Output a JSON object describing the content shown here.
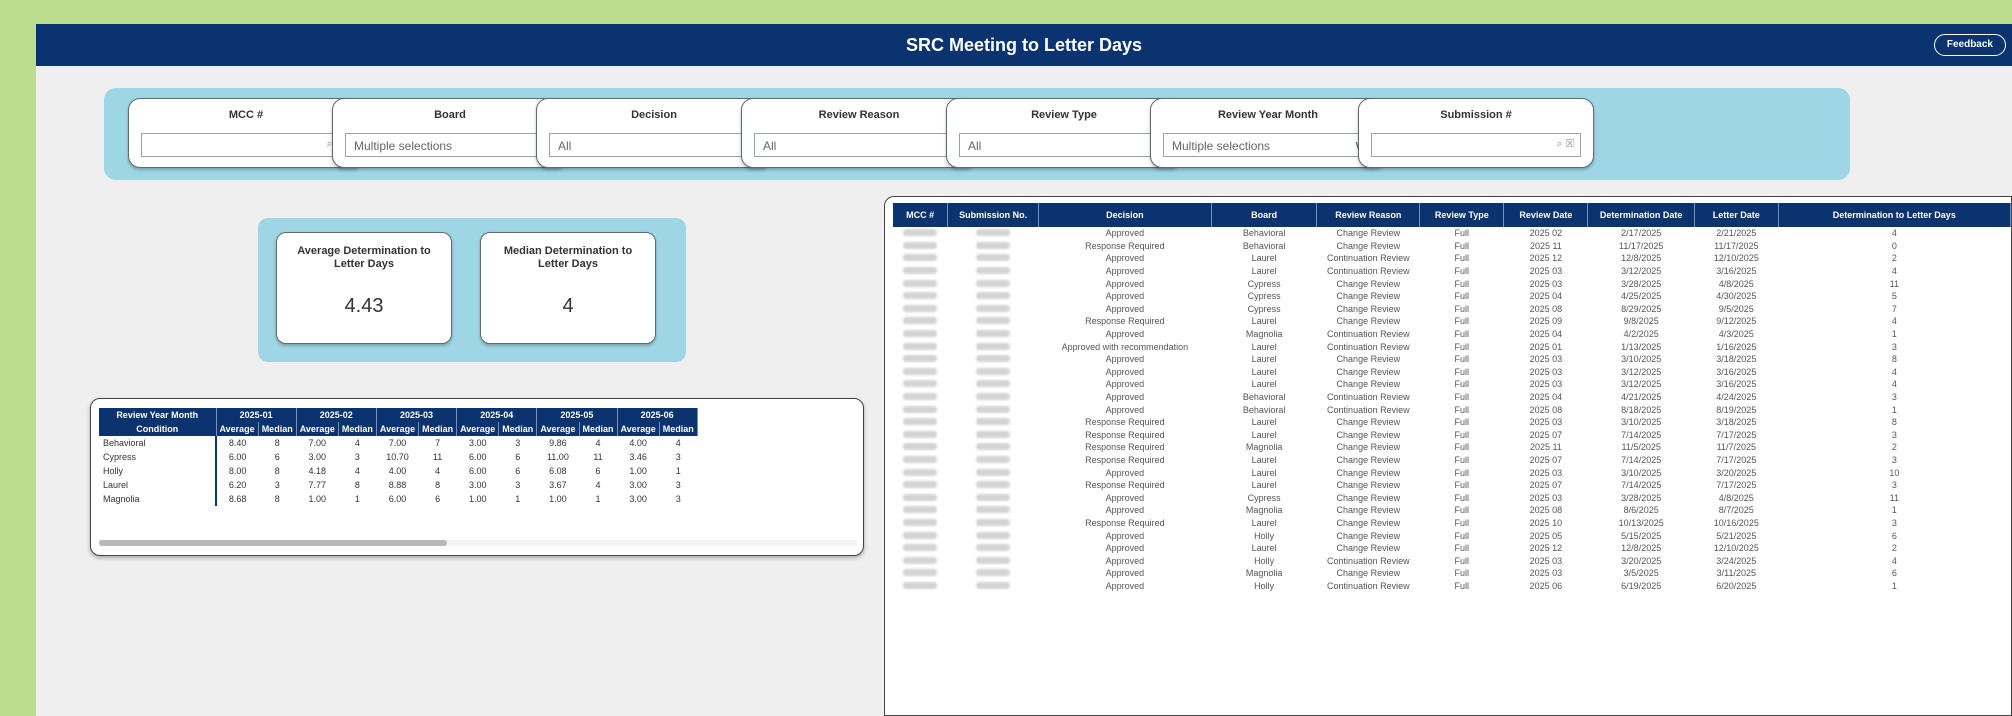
{
  "header": {
    "title": "SRC Meeting to Letter Days",
    "feedback_label": "Feedback"
  },
  "filters": [
    {
      "label": "MCC #",
      "value": "",
      "kind": "search"
    },
    {
      "label": "Board",
      "value": "Multiple selections",
      "kind": "dropdown"
    },
    {
      "label": "Decision",
      "value": "All",
      "kind": "dropdown"
    },
    {
      "label": "Review Reason",
      "value": "All",
      "kind": "dropdown"
    },
    {
      "label": "Review Type",
      "value": "All",
      "kind": "dropdown"
    },
    {
      "label": "Review Year Month",
      "value": "Multiple selections",
      "kind": "dropdown"
    },
    {
      "label": "Submission #",
      "value": "",
      "kind": "search"
    }
  ],
  "kpis": [
    {
      "label": "Average Determination to Letter Days",
      "value": "4.43"
    },
    {
      "label": "Median Determination to Letter Days",
      "value": "4"
    }
  ],
  "matrix": {
    "corner_top": "Review Year Month",
    "corner_bottom": "Condition",
    "months": [
      "2025-01",
      "2025-02",
      "2025-03",
      "2025-04",
      "2025-05",
      "2025-06"
    ],
    "sub_headers": [
      "Average",
      "Median"
    ],
    "rows": [
      {
        "condition": "Behavioral",
        "values": [
          "8.40",
          "8",
          "7.00",
          "4",
          "7.00",
          "7",
          "3.00",
          "3",
          "9.86",
          "4",
          "4.00",
          "4"
        ]
      },
      {
        "condition": "Cypress",
        "values": [
          "6.00",
          "6",
          "3.00",
          "3",
          "10.70",
          "11",
          "6.00",
          "6",
          "11.00",
          "11",
          "3.46",
          "3"
        ]
      },
      {
        "condition": "Holly",
        "values": [
          "8.00",
          "8",
          "4.18",
          "4",
          "4.00",
          "4",
          "6.00",
          "6",
          "6.08",
          "6",
          "1.00",
          "1"
        ]
      },
      {
        "condition": "Laurel",
        "values": [
          "6.20",
          "3",
          "7.77",
          "8",
          "8.88",
          "8",
          "3.00",
          "3",
          "3.67",
          "4",
          "3.00",
          "3"
        ]
      },
      {
        "condition": "Magnolia",
        "values": [
          "8.68",
          "8",
          "1.00",
          "1",
          "6.00",
          "6",
          "1.00",
          "1",
          "1.00",
          "1",
          "3.00",
          "3"
        ]
      }
    ]
  },
  "detail": {
    "columns": [
      "MCC #",
      "Submission No.",
      "Decision",
      "Board",
      "Review Reason",
      "Review Type",
      "Review Date",
      "Determination Date",
      "Letter Date",
      "Determination to Letter Days"
    ],
    "rows": [
      [
        "Approved",
        "Behavioral",
        "Change Review",
        "Full",
        "2025 02",
        "2/17/2025",
        "2/21/2025",
        "4"
      ],
      [
        "Response Required",
        "Behavioral",
        "Change Review",
        "Full",
        "2025 11",
        "11/17/2025",
        "11/17/2025",
        "0"
      ],
      [
        "Approved",
        "Laurel",
        "Continuation Review",
        "Full",
        "2025 12",
        "12/8/2025",
        "12/10/2025",
        "2"
      ],
      [
        "Approved",
        "Laurel",
        "Continuation Review",
        "Full",
        "2025 03",
        "3/12/2025",
        "3/16/2025",
        "4"
      ],
      [
        "Approved",
        "Cypress",
        "Change Review",
        "Full",
        "2025 03",
        "3/28/2025",
        "4/8/2025",
        "11"
      ],
      [
        "Approved",
        "Cypress",
        "Change Review",
        "Full",
        "2025 04",
        "4/25/2025",
        "4/30/2025",
        "5"
      ],
      [
        "Approved",
        "Cypress",
        "Change Review",
        "Full",
        "2025 08",
        "8/29/2025",
        "9/5/2025",
        "7"
      ],
      [
        "Response Required",
        "Laurel",
        "Change Review",
        "Full",
        "2025 09",
        "9/8/2025",
        "9/12/2025",
        "4"
      ],
      [
        "Approved",
        "Magnolia",
        "Continuation Review",
        "Full",
        "2025 04",
        "4/2/2025",
        "4/3/2025",
        "1"
      ],
      [
        "Approved with recommendation",
        "Laurel",
        "Continuation Review",
        "Full",
        "2025 01",
        "1/13/2025",
        "1/16/2025",
        "3"
      ],
      [
        "Approved",
        "Laurel",
        "Change Review",
        "Full",
        "2025 03",
        "3/10/2025",
        "3/18/2025",
        "8"
      ],
      [
        "Approved",
        "Laurel",
        "Change Review",
        "Full",
        "2025 03",
        "3/12/2025",
        "3/16/2025",
        "4"
      ],
      [
        "Approved",
        "Laurel",
        "Change Review",
        "Full",
        "2025 03",
        "3/12/2025",
        "3/16/2025",
        "4"
      ],
      [
        "Approved",
        "Behavioral",
        "Continuation Review",
        "Full",
        "2025 04",
        "4/21/2025",
        "4/24/2025",
        "3"
      ],
      [
        "Approved",
        "Behavioral",
        "Continuation Review",
        "Full",
        "2025 08",
        "8/18/2025",
        "8/19/2025",
        "1"
      ],
      [
        "Response Required",
        "Laurel",
        "Change Review",
        "Full",
        "2025 03",
        "3/10/2025",
        "3/18/2025",
        "8"
      ],
      [
        "Response Required",
        "Laurel",
        "Change Review",
        "Full",
        "2025 07",
        "7/14/2025",
        "7/17/2025",
        "3"
      ],
      [
        "Response Required",
        "Magnolia",
        "Change Review",
        "Full",
        "2025 11",
        "11/5/2025",
        "11/7/2025",
        "2"
      ],
      [
        "Response Required",
        "Laurel",
        "Change Review",
        "Full",
        "2025 07",
        "7/14/2025",
        "7/17/2025",
        "3"
      ],
      [
        "Approved",
        "Laurel",
        "Change Review",
        "Full",
        "2025 03",
        "3/10/2025",
        "3/20/2025",
        "10"
      ],
      [
        "Response Required",
        "Laurel",
        "Change Review",
        "Full",
        "2025 07",
        "7/14/2025",
        "7/17/2025",
        "3"
      ],
      [
        "Approved",
        "Cypress",
        "Change Review",
        "Full",
        "2025 03",
        "3/28/2025",
        "4/8/2025",
        "11"
      ],
      [
        "Approved",
        "Magnolia",
        "Change Review",
        "Full",
        "2025 08",
        "8/6/2025",
        "8/7/2025",
        "1"
      ],
      [
        "Response Required",
        "Laurel",
        "Change Review",
        "Full",
        "2025 10",
        "10/13/2025",
        "10/16/2025",
        "3"
      ],
      [
        "Approved",
        "Holly",
        "Change Review",
        "Full",
        "2025 05",
        "5/15/2025",
        "5/21/2025",
        "6"
      ],
      [
        "Approved",
        "Laurel",
        "Change Review",
        "Full",
        "2025 12",
        "12/8/2025",
        "12/10/2025",
        "2"
      ],
      [
        "Approved",
        "Holly",
        "Continuation Review",
        "Full",
        "2025 03",
        "3/20/2025",
        "3/24/2025",
        "4"
      ],
      [
        "Approved",
        "Magnolia",
        "Change Review",
        "Full",
        "2025 03",
        "3/5/2025",
        "3/11/2025",
        "6"
      ],
      [
        "Approved",
        "Holly",
        "Continuation Review",
        "Full",
        "2025 06",
        "6/19/2025",
        "6/20/2025",
        "1"
      ]
    ]
  }
}
